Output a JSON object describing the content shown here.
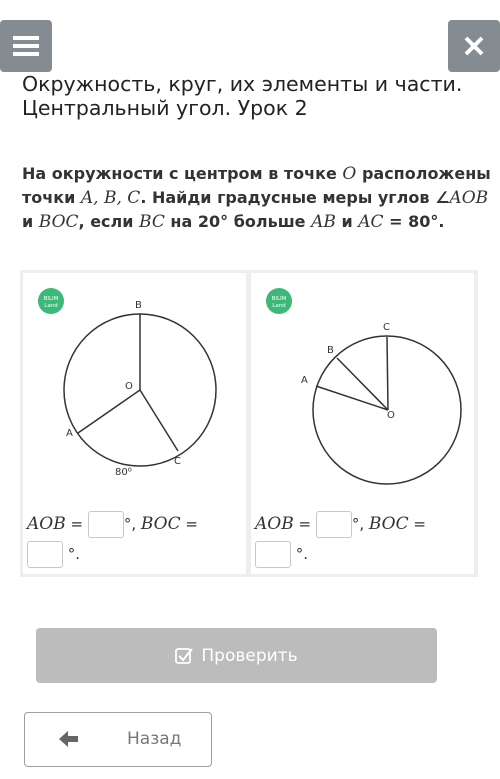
{
  "header": {
    "menu_icon": "hamburger-icon",
    "close_icon": "close-icon",
    "title_line1": "Окружность, круг, их элементы и части.",
    "title_line2": "Центральный угол. Урок 2"
  },
  "task": {
    "p1": "На окружности с центром в точке ",
    "O": "O",
    "p2": "расположены точки ",
    "A": "A",
    "c1": ", ",
    "B": "B",
    "c2": ", ",
    "C": "C",
    "p3": ". Найди градусные меры углов ∠",
    "AOB": "AOB",
    "p4": " и ",
    "BOC": "BOC",
    "p5": ", если ",
    "BC": "BC",
    "p6": " на 20° больше ",
    "AB": "AB",
    "p7": " и ",
    "AC": "AC",
    "p8": " = 80°."
  },
  "figures": {
    "logo_line1": "BILIM",
    "logo_line2": "Land",
    "left": {
      "B": "B",
      "O": "O",
      "A": "A",
      "C": "C",
      "arc": "80⁰"
    },
    "right": {
      "C": "C",
      "B": "B",
      "A": "A",
      "O": "O"
    }
  },
  "answers": {
    "left": {
      "aob": "AOB",
      "eq1": " = ",
      "deg1": "°, ",
      "boc": "BOC",
      "eq2": " = ",
      "deg2": "°."
    },
    "right": {
      "aob": "AOB",
      "eq1": " = ",
      "deg1": "°, ",
      "boc": "BOC",
      "eq2": " = ",
      "deg2": "°."
    }
  },
  "buttons": {
    "check_label": "Проверить",
    "check_icon": "checkbox-icon",
    "back_label": "Назад",
    "back_icon": "arrow-left-icon"
  },
  "colors": {
    "header_button": "#848c91",
    "check_button": "#bcbcbc",
    "logo_green": "#3cb878"
  }
}
